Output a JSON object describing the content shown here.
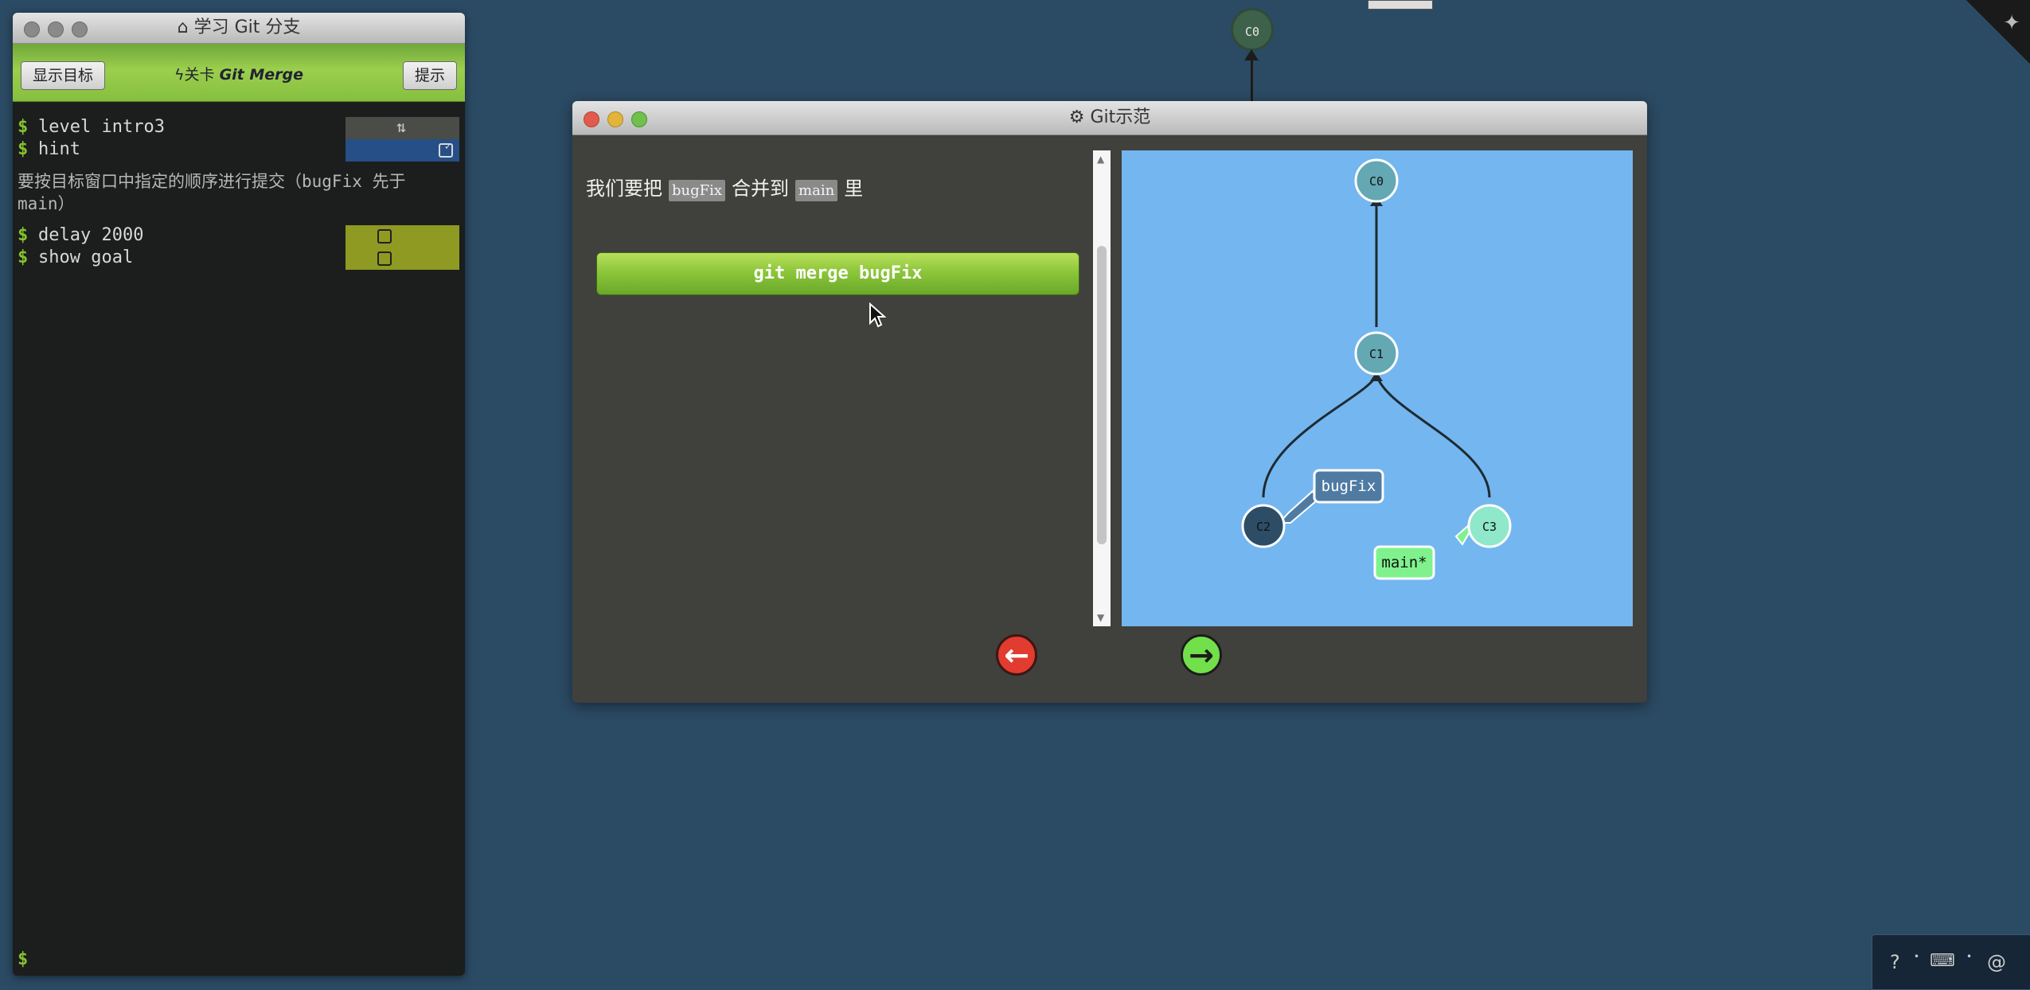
{
  "terminal": {
    "window_title": "学习 Git 分支",
    "goal_button": "显示目标",
    "hint_button": "提示",
    "level_prefix": "关卡",
    "level_name": "Git Merge",
    "commands": [
      {
        "prompt": "$",
        "text": "level intro3"
      },
      {
        "prompt": "$",
        "text": "hint"
      },
      {
        "prompt": "$",
        "text": "delay 2000"
      },
      {
        "prompt": "$",
        "text": "show goal"
      }
    ],
    "hint_text": "要按目标窗口中指定的顺序进行提交（bugFix 先于 main）",
    "bottom_prompt": "$"
  },
  "background": {
    "commit_label": "C0"
  },
  "demo": {
    "window_title": "Git示范",
    "explain_before": "我们要把",
    "explain_tag1": "bugFix",
    "explain_middle": "合并到",
    "explain_tag2": "main",
    "explain_after": "里",
    "command": "git merge bugFix",
    "graph": {
      "commits": [
        "C0",
        "C1",
        "C2",
        "C3"
      ],
      "branches": [
        {
          "name": "bugFix",
          "target": "C2"
        },
        {
          "name": "main*",
          "target": "C3"
        }
      ],
      "colors": {
        "background": "#74b6ef",
        "c0_c1": "#64a8b4",
        "c2": "#2d4d66",
        "c3": "#8ee8c9",
        "bugfix_label": "#4f7ba3",
        "main_label": "#7ff28e"
      }
    }
  }
}
